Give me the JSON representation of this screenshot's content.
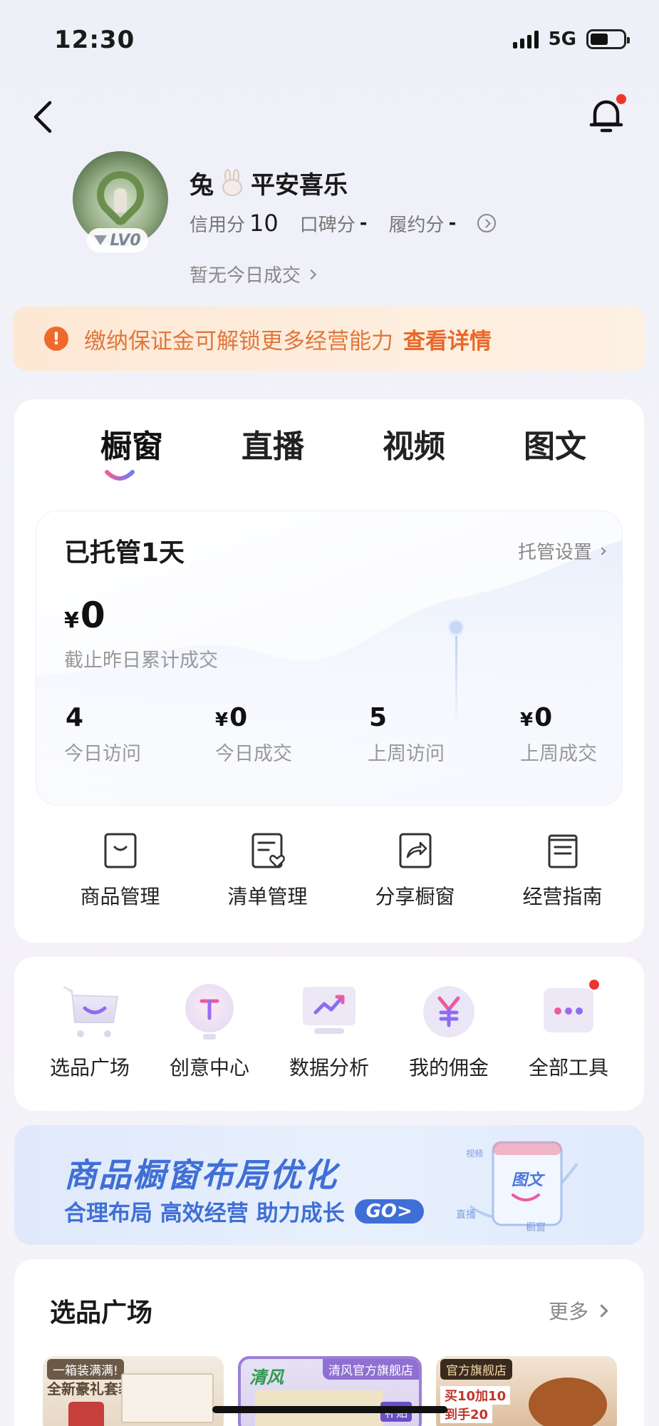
{
  "status_bar": {
    "time": "12:30",
    "network": "5G"
  },
  "profile": {
    "nickname_part1": "兔",
    "nickname_part2": "平安喜乐",
    "level": "LV0",
    "credit_label": "信用分",
    "credit_value": "10",
    "reputation_label": "口碑分",
    "reputation_value": "-",
    "fulfillment_label": "履约分",
    "fulfillment_value": "-",
    "today_deal": "暂无今日成交"
  },
  "notice": {
    "text": "缴纳保证金可解锁更多经营能力",
    "link": "查看详情"
  },
  "tabs": [
    {
      "label": "橱窗",
      "active": true
    },
    {
      "label": "直播"
    },
    {
      "label": "视频"
    },
    {
      "label": "图文"
    }
  ],
  "stats": {
    "title": "已托管1天",
    "setting": "托管设置",
    "currency": "¥",
    "cumulative_value": "0",
    "cumulative_label": "截止昨日累计成交",
    "kpis": [
      {
        "value": "4",
        "label": "今日访问",
        "currency": ""
      },
      {
        "value": "0",
        "label": "今日成交",
        "currency": "¥"
      },
      {
        "value": "5",
        "label": "上周访问",
        "currency": ""
      },
      {
        "value": "0",
        "label": "上周成交",
        "currency": "¥"
      }
    ]
  },
  "window_tools": [
    {
      "label": "商品管理",
      "icon": "bag-icon"
    },
    {
      "label": "清单管理",
      "icon": "list-heart-icon"
    },
    {
      "label": "分享橱窗",
      "icon": "share-icon"
    },
    {
      "label": "经营指南",
      "icon": "guide-icon"
    }
  ],
  "tools": [
    {
      "label": "选品广场",
      "icon": "cart-icon"
    },
    {
      "label": "创意中心",
      "icon": "bulb-icon"
    },
    {
      "label": "数据分析",
      "icon": "chart-icon"
    },
    {
      "label": "我的佣金",
      "icon": "yen-icon"
    },
    {
      "label": "全部工具",
      "icon": "more-icon",
      "badge": true
    }
  ],
  "banner": {
    "title": "商品橱窗布局优化",
    "subtitle": "合理布局 高效经营 助力成长",
    "go": "GO>",
    "art_labels": [
      "视频",
      "图文",
      "直播",
      "橱窗"
    ]
  },
  "selection": {
    "title": "选品广场",
    "more": "更多",
    "products": [
      {
        "tag": "一箱装满满!",
        "caption": "全新豪礼套装"
      },
      {
        "brand": "清风",
        "tag": "清风官方旗舰店",
        "caption": "补贴"
      },
      {
        "tag": "官方旗舰店",
        "caption": "买10加10",
        "caption2": "到手20"
      }
    ]
  },
  "colors": {
    "accent": "#3f6fd6",
    "warning": "#e8682a",
    "badge": "#f0352c"
  }
}
